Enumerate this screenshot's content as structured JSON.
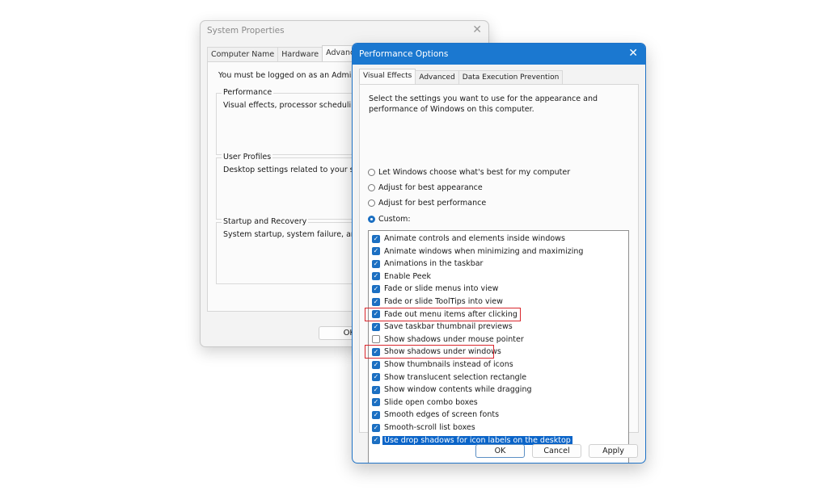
{
  "system_properties": {
    "title": "System Properties",
    "close_icon": "close-icon",
    "tabs": [
      {
        "label": "Computer Name",
        "active": false
      },
      {
        "label": "Hardware",
        "active": false
      },
      {
        "label": "Advanced",
        "active": true
      }
    ],
    "admin_message": "You must be logged on as an Administrat",
    "groups": [
      {
        "legend": "Performance",
        "description": "Visual effects, processor scheduling, me"
      },
      {
        "legend": "User Profiles",
        "description": "Desktop settings related to your sign-in"
      },
      {
        "legend": "Startup and Recovery",
        "description": "System startup, system failure, and debu"
      }
    ],
    "ok_label": "OK"
  },
  "performance_options": {
    "title": "Performance Options",
    "close_icon": "close-icon",
    "tabs": [
      {
        "label": "Visual Effects",
        "active": true
      },
      {
        "label": "Advanced",
        "active": false
      },
      {
        "label": "Data Execution Prevention",
        "active": false
      }
    ],
    "description": "Select the settings you want to use for the appearance and performance of Windows on this computer.",
    "radio_options": [
      {
        "label": "Let Windows choose what's best for my computer",
        "checked": false
      },
      {
        "label": "Adjust for best appearance",
        "checked": false
      },
      {
        "label": "Adjust for best performance",
        "checked": false
      },
      {
        "label": "Custom:",
        "checked": true
      }
    ],
    "effects": [
      {
        "label": "Animate controls and elements inside windows",
        "checked": true
      },
      {
        "label": "Animate windows when minimizing and maximizing",
        "checked": true
      },
      {
        "label": "Animations in the taskbar",
        "checked": true
      },
      {
        "label": "Enable Peek",
        "checked": true
      },
      {
        "label": "Fade or slide menus into view",
        "checked": true
      },
      {
        "label": "Fade or slide ToolTips into view",
        "checked": true
      },
      {
        "label": "Fade out menu items after clicking",
        "checked": true,
        "highlighted": true
      },
      {
        "label": "Save taskbar thumbnail previews",
        "checked": true
      },
      {
        "label": "Show shadows under mouse pointer",
        "checked": false
      },
      {
        "label": "Show shadows under windows",
        "checked": true,
        "highlighted": true
      },
      {
        "label": "Show thumbnails instead of icons",
        "checked": true
      },
      {
        "label": "Show translucent selection rectangle",
        "checked": true
      },
      {
        "label": "Show window contents while dragging",
        "checked": true
      },
      {
        "label": "Slide open combo boxes",
        "checked": true
      },
      {
        "label": "Smooth edges of screen fonts",
        "checked": true
      },
      {
        "label": "Smooth-scroll list boxes",
        "checked": true
      },
      {
        "label": "Use drop shadows for icon labels on the desktop",
        "checked": true,
        "selected": true
      }
    ],
    "buttons": {
      "ok": "OK",
      "cancel": "Cancel",
      "apply": "Apply"
    },
    "colors": {
      "accent": "#1b78d0",
      "highlight_annotation": "#d9262c",
      "selection": "#0a64c8"
    }
  }
}
